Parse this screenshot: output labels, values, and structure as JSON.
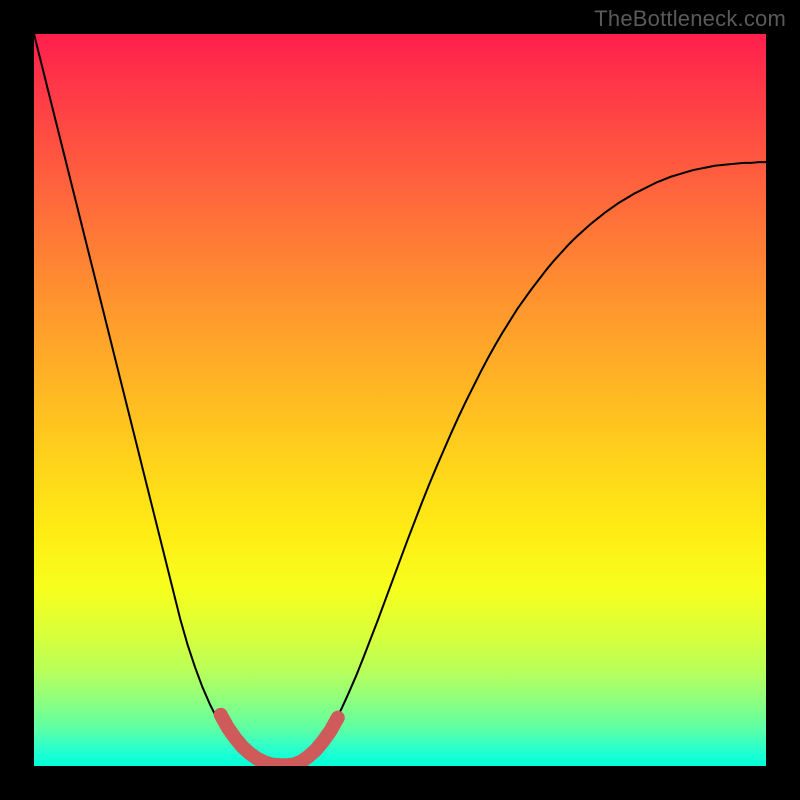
{
  "watermark": {
    "text": "TheBottleneck.com"
  },
  "chart_data": {
    "type": "line",
    "title": "",
    "xlabel": "",
    "ylabel": "",
    "x": [
      0.0,
      0.01,
      0.02,
      0.03,
      0.04,
      0.05,
      0.06,
      0.07,
      0.08,
      0.09,
      0.1,
      0.11,
      0.12,
      0.13,
      0.14,
      0.15,
      0.16,
      0.17,
      0.18,
      0.19,
      0.2,
      0.21,
      0.22,
      0.23,
      0.24,
      0.25,
      0.26,
      0.27,
      0.28,
      0.29,
      0.3,
      0.31,
      0.32,
      0.33,
      0.34,
      0.35,
      0.36,
      0.37,
      0.38,
      0.39,
      0.4,
      0.41,
      0.42,
      0.43,
      0.44,
      0.45,
      0.46,
      0.47,
      0.48,
      0.49,
      0.5,
      0.51,
      0.52,
      0.53,
      0.54,
      0.55,
      0.56,
      0.57,
      0.58,
      0.59,
      0.6,
      0.61,
      0.62,
      0.63,
      0.64,
      0.65,
      0.66,
      0.67,
      0.68,
      0.69,
      0.7,
      0.71,
      0.72,
      0.73,
      0.74,
      0.75,
      0.76,
      0.77,
      0.78,
      0.79,
      0.8,
      0.81,
      0.82,
      0.83,
      0.84,
      0.85,
      0.86,
      0.87,
      0.88,
      0.89,
      0.9,
      0.91,
      0.92,
      0.93,
      0.94,
      0.95,
      0.96,
      0.97,
      0.98,
      0.99,
      1.0
    ],
    "values": [
      1.0,
      0.96,
      0.92,
      0.88,
      0.84,
      0.8,
      0.76,
      0.72,
      0.68,
      0.64,
      0.6,
      0.56,
      0.52,
      0.48,
      0.44,
      0.4,
      0.36,
      0.32,
      0.28,
      0.24,
      0.2,
      0.165,
      0.135,
      0.108,
      0.085,
      0.065,
      0.048,
      0.034,
      0.022,
      0.013,
      0.007,
      0.003,
      0.001,
      0.0,
      0.0,
      0.002,
      0.005,
      0.01,
      0.018,
      0.028,
      0.042,
      0.059,
      0.078,
      0.1,
      0.123,
      0.148,
      0.174,
      0.2,
      0.227,
      0.254,
      0.281,
      0.308,
      0.334,
      0.36,
      0.385,
      0.409,
      0.432,
      0.455,
      0.477,
      0.498,
      0.518,
      0.538,
      0.557,
      0.575,
      0.592,
      0.608,
      0.624,
      0.638,
      0.652,
      0.665,
      0.678,
      0.69,
      0.701,
      0.712,
      0.722,
      0.731,
      0.74,
      0.748,
      0.756,
      0.763,
      0.77,
      0.776,
      0.782,
      0.787,
      0.792,
      0.797,
      0.801,
      0.805,
      0.808,
      0.811,
      0.814,
      0.816,
      0.818,
      0.82,
      0.821,
      0.822,
      0.823,
      0.824,
      0.824,
      0.825,
      0.825
    ],
    "highlight": {
      "x": [
        0.255,
        0.265,
        0.275,
        0.285,
        0.295,
        0.305,
        0.315,
        0.325,
        0.335,
        0.345,
        0.355,
        0.365,
        0.375,
        0.385,
        0.395,
        0.405,
        0.415
      ],
      "y": [
        0.07,
        0.052,
        0.038,
        0.026,
        0.017,
        0.01,
        0.005,
        0.002,
        0.001,
        0.001,
        0.002,
        0.006,
        0.013,
        0.022,
        0.034,
        0.048,
        0.066
      ]
    },
    "xlim": [
      0,
      1
    ],
    "ylim": [
      0,
      1
    ],
    "legend": null,
    "grid": false
  },
  "colors": {
    "curve": "#000000",
    "highlight": "#cf5a5a",
    "frame": "#000000"
  }
}
